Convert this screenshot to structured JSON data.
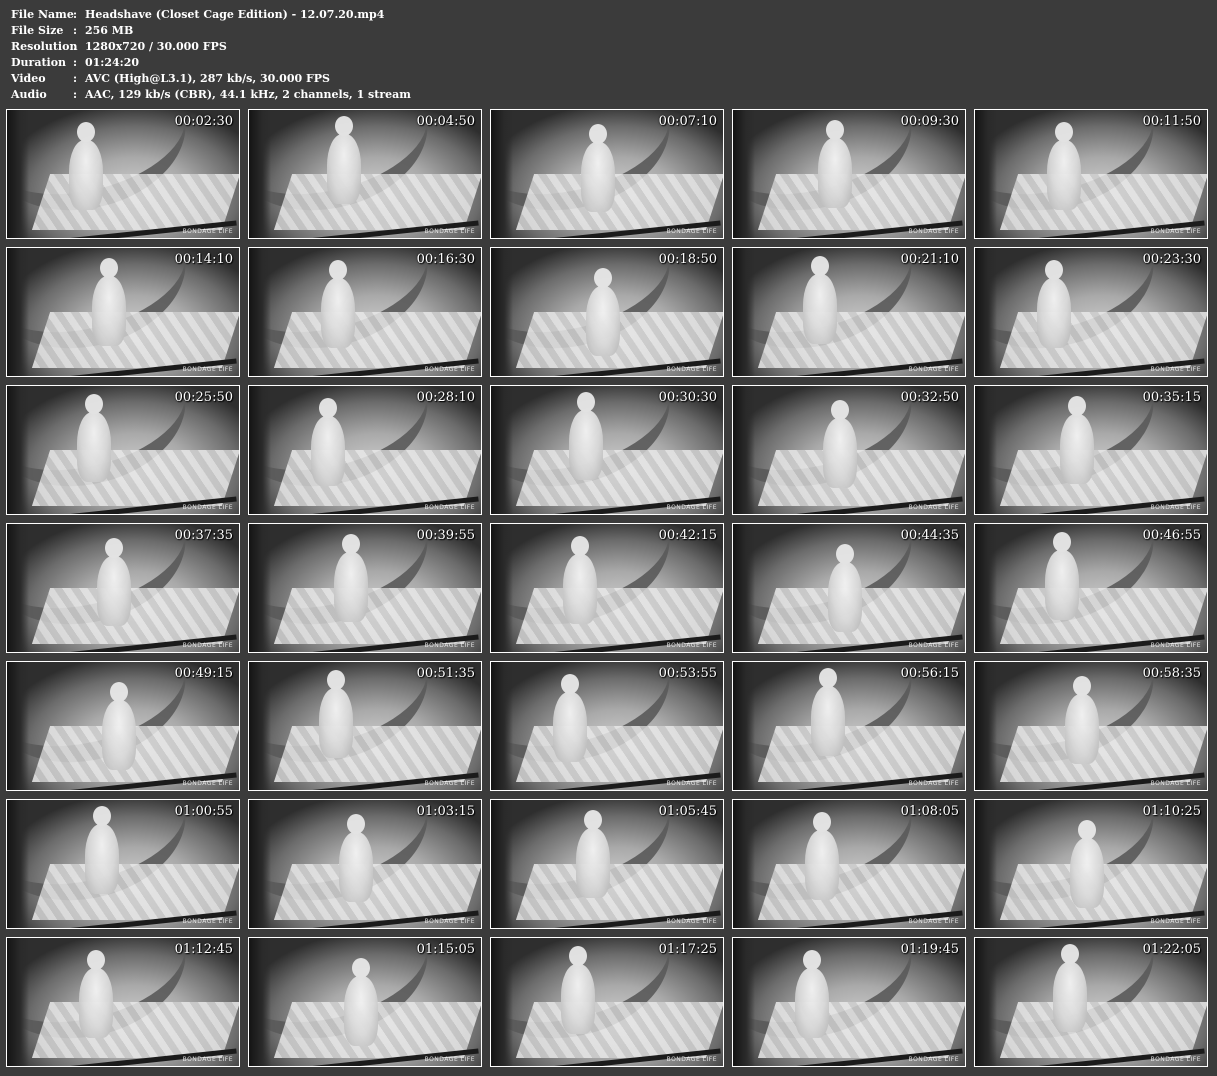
{
  "info": {
    "rows": [
      {
        "key": "File Name",
        "value": "Headshave (Closet Cage Edition) - 12.07.20.mp4"
      },
      {
        "key": "File Size",
        "value": "256 MB"
      },
      {
        "key": "Resolution",
        "value": "1280x720 / 30.000 FPS"
      },
      {
        "key": "Duration",
        "value": "01:24:20"
      },
      {
        "key": "Video",
        "value": "AVC (High@L3.1), 287 kb/s, 30.000 FPS"
      },
      {
        "key": "Audio",
        "value": "AAC, 129 kb/s (CBR), 44.1 kHz, 2 channels, 1 stream"
      }
    ],
    "separator": ":"
  },
  "watermark": "BONDAGE LIFE",
  "thumbnails": [
    "00:02:30",
    "00:04:50",
    "00:07:10",
    "00:09:30",
    "00:11:50",
    "00:14:10",
    "00:16:30",
    "00:18:50",
    "00:21:10",
    "00:23:30",
    "00:25:50",
    "00:28:10",
    "00:30:30",
    "00:32:50",
    "00:35:15",
    "00:37:35",
    "00:39:55",
    "00:42:15",
    "00:44:35",
    "00:46:55",
    "00:49:15",
    "00:51:35",
    "00:53:55",
    "00:56:15",
    "00:58:35",
    "01:00:55",
    "01:03:15",
    "01:05:45",
    "01:08:05",
    "01:10:25",
    "01:12:45",
    "01:15:05",
    "01:17:25",
    "01:19:45",
    "01:22:05"
  ]
}
